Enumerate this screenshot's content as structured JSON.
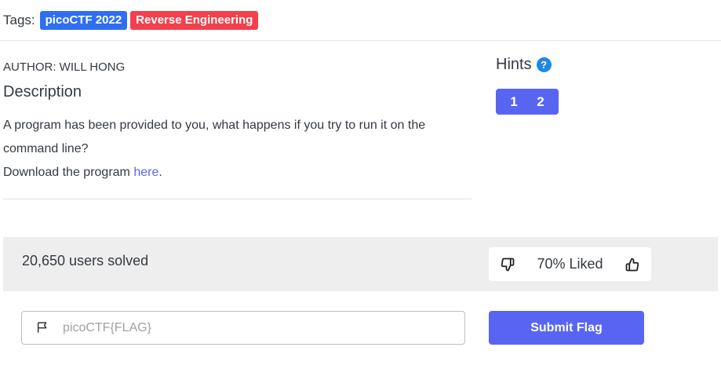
{
  "tags": {
    "label": "Tags:",
    "items": [
      {
        "text": "picoCTF 2022",
        "color": "#2f6ef2"
      },
      {
        "text": "Reverse Engineering",
        "color": "#f2404c"
      }
    ]
  },
  "challenge": {
    "author": "AUTHOR: WILL HONG",
    "description_title": "Description",
    "description_line1": "A program has been provided to you, what happens if you try to run it on the command line?",
    "download_prefix": "Download the program ",
    "download_link": "here",
    "download_suffix": "."
  },
  "hints": {
    "title": "Hints",
    "help_icon": "?",
    "buttons": [
      "1",
      "2"
    ]
  },
  "stats": {
    "solved": "20,650 users solved",
    "liked": "70% Liked",
    "dislike_icon": "thumbs-down-icon",
    "like_icon": "thumbs-up-icon"
  },
  "flag_form": {
    "placeholder": "picoCTF{FLAG}",
    "value": "",
    "submit_label": "Submit Flag",
    "accent": "#5865f2"
  }
}
